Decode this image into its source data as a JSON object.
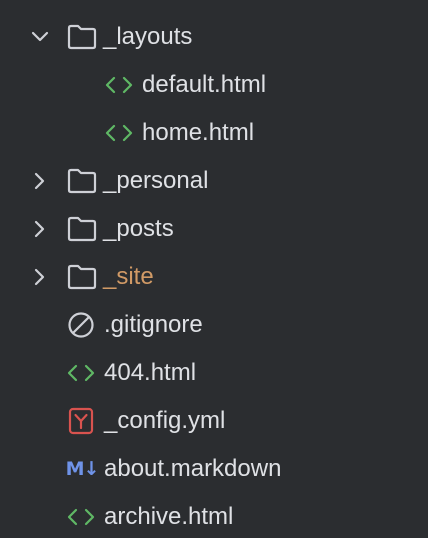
{
  "tree": {
    "items": [
      {
        "label": "_layouts",
        "type": "folder",
        "expanded": true
      },
      {
        "label": "default.html",
        "type": "html"
      },
      {
        "label": "home.html",
        "type": "html"
      },
      {
        "label": "_personal",
        "type": "folder",
        "expanded": false
      },
      {
        "label": "_posts",
        "type": "folder",
        "expanded": false
      },
      {
        "label": "_site",
        "type": "folder",
        "expanded": false,
        "excluded": true
      },
      {
        "label": ".gitignore",
        "type": "ignore"
      },
      {
        "label": "404.html",
        "type": "html"
      },
      {
        "label": "_config.yml",
        "type": "yaml"
      },
      {
        "label": "about.markdown",
        "type": "markdown"
      },
      {
        "label": "archive.html",
        "type": "html"
      }
    ],
    "icons": {
      "markdown_glyph": "M↓",
      "yaml_glyph": "Y"
    },
    "colors": {
      "background": "#2b2d30",
      "text": "#dfe1e5",
      "excluded_text": "#d19a66",
      "html_icon": "#5fb865",
      "yaml_icon": "#d9534f",
      "markdown_icon": "#6f93e8",
      "folder_icon": "#ced0d6"
    }
  }
}
